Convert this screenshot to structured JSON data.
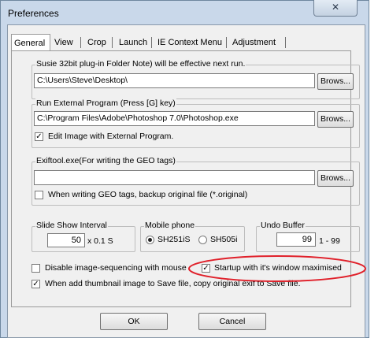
{
  "window": {
    "title": "Preferences",
    "close_glyph": "✕"
  },
  "tabs": [
    {
      "label": "General",
      "selected": true
    },
    {
      "label": "View"
    },
    {
      "label": "Crop"
    },
    {
      "label": "Launch"
    },
    {
      "label": "IE Context Menu"
    },
    {
      "label": "Adjustment"
    }
  ],
  "susie": {
    "legend": "Susie 32bit plug-in Folder  Note) will be effective next run.",
    "path": "C:\\Users\\Steve\\Desktop\\",
    "browse_label": "Brows..."
  },
  "external": {
    "legend": "Run External Program (Press [G] key)",
    "path": "C:\\Program Files\\Adobe\\Photoshop 7.0\\Photoshop.exe",
    "browse_label": "Brows...",
    "edit_label": "Edit Image with External Program.",
    "edit_checked": true,
    "check_glyph": "✓"
  },
  "exiftool": {
    "legend": "Exiftool.exe(For writing the GEO tags)",
    "path": "",
    "browse_label": "Brows...",
    "backup_label": "When writing GEO tags, backup original file (*.original)",
    "backup_checked": false
  },
  "slideshow": {
    "legend": "Slide Show Interval",
    "value": "50",
    "unit": "x 0.1 S"
  },
  "mobile": {
    "legend": "Mobile phone",
    "option1": "SH251iS",
    "option2": "SH505i",
    "selected": "SH251iS"
  },
  "undo": {
    "legend": "Undo Buffer",
    "value": "99",
    "range": "1 - 99"
  },
  "options": {
    "disable_seq_label": "Disable  image-sequencing with mouse",
    "startup_max_label": "Startup with it's window maximised",
    "thumb_exif_label": "When add thumbnail image to Save file, copy original exif to Save file."
  },
  "footer": {
    "ok_label": "OK",
    "cancel_label": "Cancel"
  },
  "annotation_color": "#e0202a"
}
